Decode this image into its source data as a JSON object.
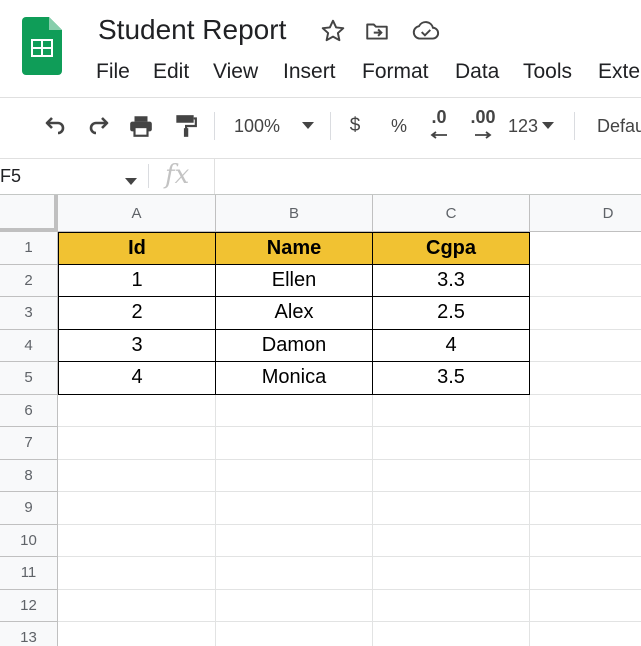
{
  "app": {
    "document_title": "Student Report",
    "icons": [
      "sheets-logo-icon",
      "star-icon",
      "move-to-folder-icon",
      "cloud-saved-icon"
    ]
  },
  "menu": [
    "File",
    "Edit",
    "View",
    "Insert",
    "Format",
    "Data",
    "Tools",
    "Exte"
  ],
  "toolbar": {
    "zoom": "100%",
    "currency": "$",
    "percent": "%",
    "decrease_decimal": ".0",
    "increase_decimal": ".00",
    "number_format": "123",
    "font": "Defau"
  },
  "formula_bar": {
    "cell_ref": "F5",
    "fx": "fx",
    "formula": ""
  },
  "grid": {
    "columns": [
      "A",
      "B",
      "C",
      "D"
    ],
    "rows": [
      "1",
      "2",
      "3",
      "4",
      "5",
      "6",
      "7",
      "8",
      "9",
      "10",
      "11",
      "12",
      "13"
    ],
    "header_fill": "#f1c232",
    "table_headers": [
      "Id",
      "Name",
      "Cgpa"
    ],
    "table_rows": [
      [
        "1",
        "Ellen",
        "3.3"
      ],
      [
        "2",
        "Alex",
        "2.5"
      ],
      [
        "3",
        "Damon",
        "4"
      ],
      [
        "4",
        "Monica",
        "3.5"
      ]
    ]
  }
}
